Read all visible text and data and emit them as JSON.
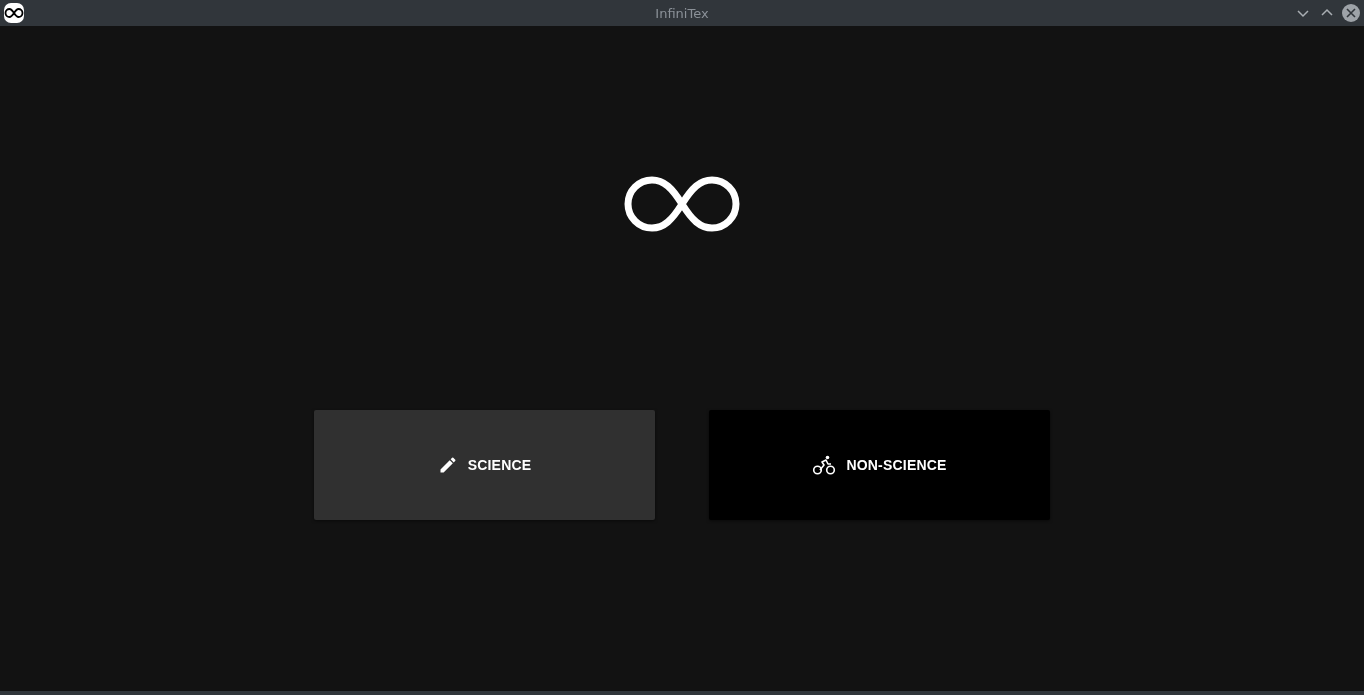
{
  "window": {
    "title": "InfiniTex"
  },
  "buttons": [
    {
      "label": "SCIENCE",
      "hovered": true
    },
    {
      "label": "NON-SCIENCE",
      "hovered": false
    }
  ]
}
